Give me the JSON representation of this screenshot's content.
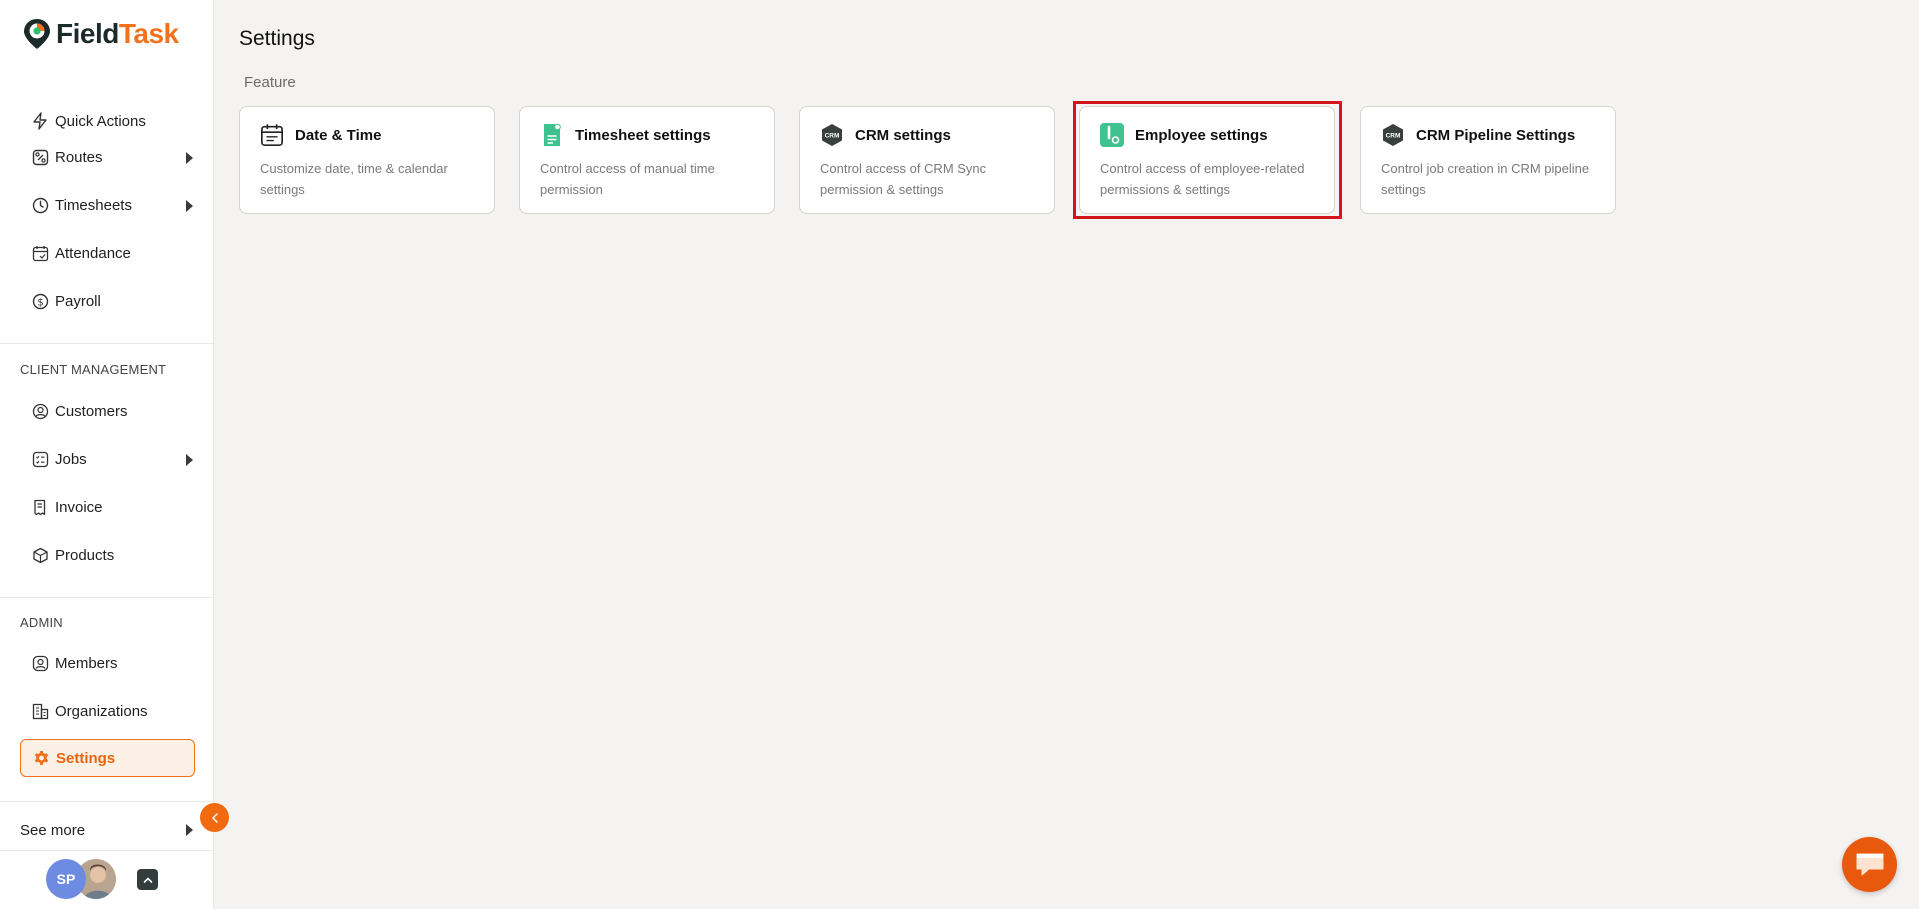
{
  "brand": {
    "part1": "Field",
    "part2": "Task"
  },
  "sidebar": {
    "top_items": [
      {
        "label": "Quick Actions"
      },
      {
        "label": "Routes"
      },
      {
        "label": "Timesheets"
      },
      {
        "label": "Attendance"
      },
      {
        "label": "Payroll"
      }
    ],
    "client_section": "CLIENT MANAGEMENT",
    "client_items": [
      {
        "label": "Customers"
      },
      {
        "label": "Jobs"
      },
      {
        "label": "Invoice"
      },
      {
        "label": "Products"
      }
    ],
    "admin_section": "ADMIN",
    "admin_items": [
      {
        "label": "Members"
      },
      {
        "label": "Organizations"
      },
      {
        "label": "Settings"
      }
    ],
    "see_more": "See more",
    "user_initials": "SP"
  },
  "main": {
    "title": "Settings",
    "section": "Feature",
    "cards": [
      {
        "title": "Date & Time",
        "desc": "Customize date, time & calendar settings"
      },
      {
        "title": "Timesheet settings",
        "desc": "Control access of manual time permission"
      },
      {
        "title": "CRM settings",
        "desc": "Control access of CRM Sync permission & settings"
      },
      {
        "title": "Employee settings",
        "desc": "Control access of employee-related permissions & settings"
      },
      {
        "title": "CRM Pipeline Settings",
        "desc": "Control job creation in CRM pipeline settings"
      }
    ],
    "crm_icon_text": "CRM"
  },
  "colors": {
    "accent": "#f2711c",
    "active_bg": "#fbf0e6",
    "highlight": "#d0161c",
    "green": "#3ec28f",
    "avatar_bg": "#6d8be0"
  }
}
